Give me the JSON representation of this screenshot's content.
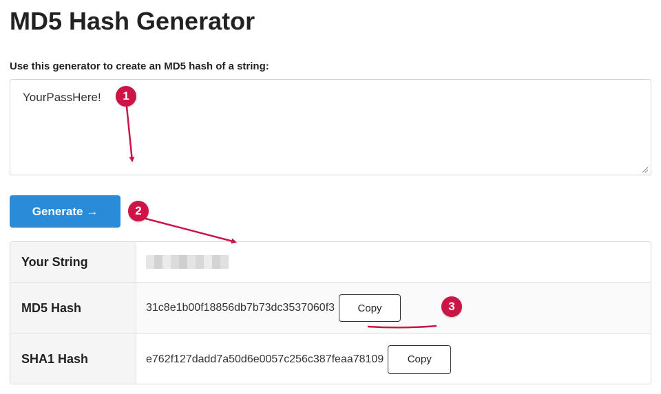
{
  "page": {
    "title": "MD5 Hash Generator",
    "prompt": "Use this generator to create an MD5 hash of a string:"
  },
  "input": {
    "value": "YourPassHere!"
  },
  "generate_button": {
    "label": "Generate →"
  },
  "results": {
    "rows": [
      {
        "label": "Your String",
        "value": ""
      },
      {
        "label": "MD5 Hash",
        "value": "31c8e1b00f18856db7b73dc3537060f3",
        "copy_label": "Copy"
      },
      {
        "label": "SHA1 Hash",
        "value": "e762f127dadd7a50d6e0057c256c387feaa78109",
        "copy_label": "Copy"
      }
    ]
  },
  "annotations": {
    "markers": [
      "1",
      "2",
      "3"
    ]
  },
  "colors": {
    "accent": "#2a8bd8",
    "annotation": "#cc1447"
  },
  "icons": {
    "resize": "resize-grip-icon",
    "arrow": "arrow-right-icon"
  }
}
